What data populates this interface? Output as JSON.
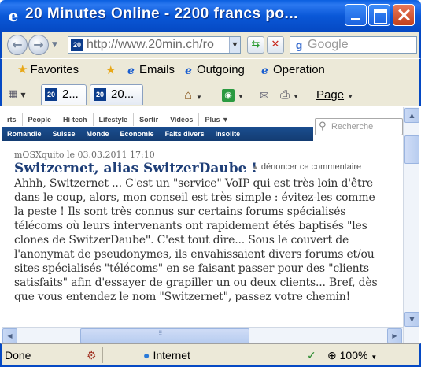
{
  "window": {
    "title": "20 Minutes Online - 2200 francs po..."
  },
  "nav": {
    "url": "http://www.20min.ch/ro",
    "search_placeholder": "Google"
  },
  "favorites": {
    "label": "Favorites",
    "links": [
      "Emails",
      "Outgoing",
      "Operation"
    ]
  },
  "tabs": [
    {
      "label": "2..."
    },
    {
      "label": "20..."
    }
  ],
  "toolbar": {
    "page_label": "Page"
  },
  "site": {
    "top_nav": [
      "rts",
      "People",
      "Hi-tech",
      "Lifestyle",
      "Sortir",
      "Vidéos",
      "Plus ▼"
    ],
    "search_placeholder": "Recherche",
    "blue_nav": [
      "Romandie",
      "Suisse",
      "Monde",
      "Economie",
      "Faits divers",
      "Insolite"
    ]
  },
  "comment": {
    "meta": "mOSXquito le 03.03.2011 17:10",
    "title": "Switzernet, alias SwitzerDaube !",
    "report_label": "dénoncer ce commentaire",
    "body": "Ahhh, Switzernet ... C'est un \"service\" VoIP qui est très loin d'être dans le coup, alors, mon conseil est très simple : évitez-les comme la peste ! Ils sont très connus sur certains forums spécialisés télécoms où leurs intervenants ont rapidement étés baptisés \"les clones de SwitzerDaube\". C'est tout dire... Sous le couvert de l'anonymat de pseudonymes, ils envahissaient divers forums et/ou sites spécialisés \"télécoms\" en se faisant passer pour des \"clients satisfaits\" afin d'essayer de grapiller un ou deux clients... Bref, dès que vous entendez le nom \"Switzernet\", passez votre chemin!"
  },
  "status": {
    "left": "Done",
    "zone": "Internet",
    "zoom": "100%"
  }
}
